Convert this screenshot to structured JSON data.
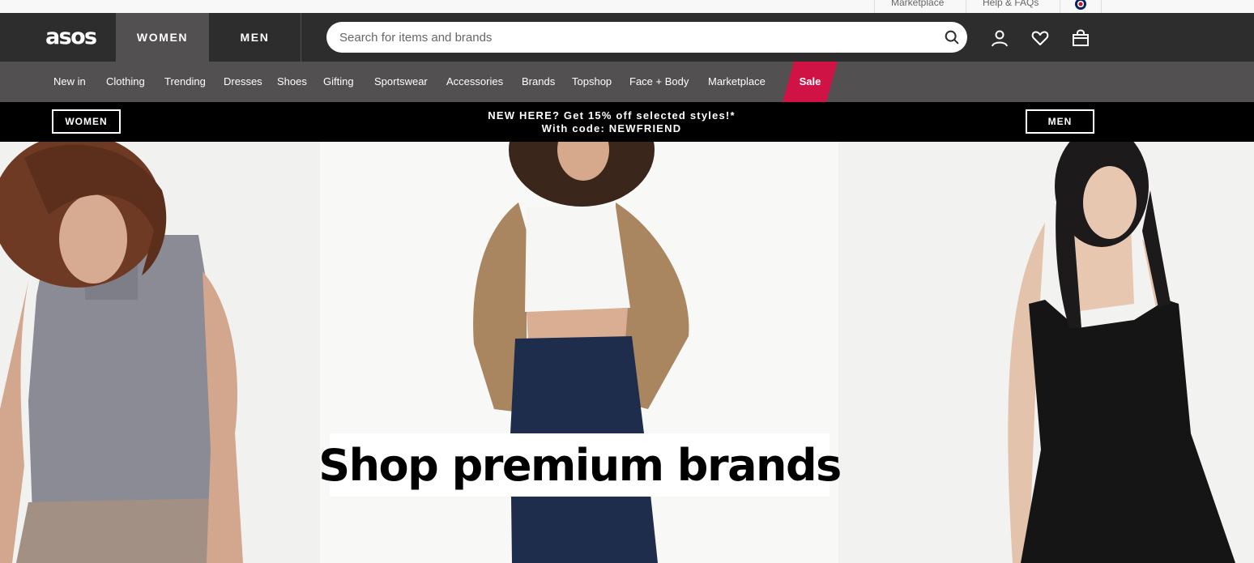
{
  "utility": {
    "marketplace": "Marketplace",
    "help": "Help & FAQs",
    "country_flag_icon": "uk-flag-icon"
  },
  "header": {
    "logo": "asos",
    "tabs": [
      "WOMEN",
      "MEN"
    ],
    "active_tab": "WOMEN",
    "search_placeholder": "Search for items and brands",
    "icons": [
      "search-icon",
      "account-icon",
      "saved-items-icon",
      "bag-icon"
    ]
  },
  "nav": {
    "items": [
      "New in",
      "Clothing",
      "Trending",
      "Dresses",
      "Shoes",
      "Gifting",
      "Sportswear",
      "Accessories",
      "Brands",
      "Topshop",
      "Face + Body",
      "Marketplace"
    ],
    "sale": "Sale"
  },
  "promo": {
    "women_button": "WOMEN",
    "men_button": "MEN",
    "line1": "NEW HERE? Get 15% off selected styles!*",
    "line2": "With code: NEWFRIEND"
  },
  "hero": {
    "title": "Shop premium brands"
  },
  "colors": {
    "header_bg": "#2d2d2d",
    "nav_bg": "#525050",
    "sale_bg": "#d01345",
    "promo_bg": "#000000"
  }
}
